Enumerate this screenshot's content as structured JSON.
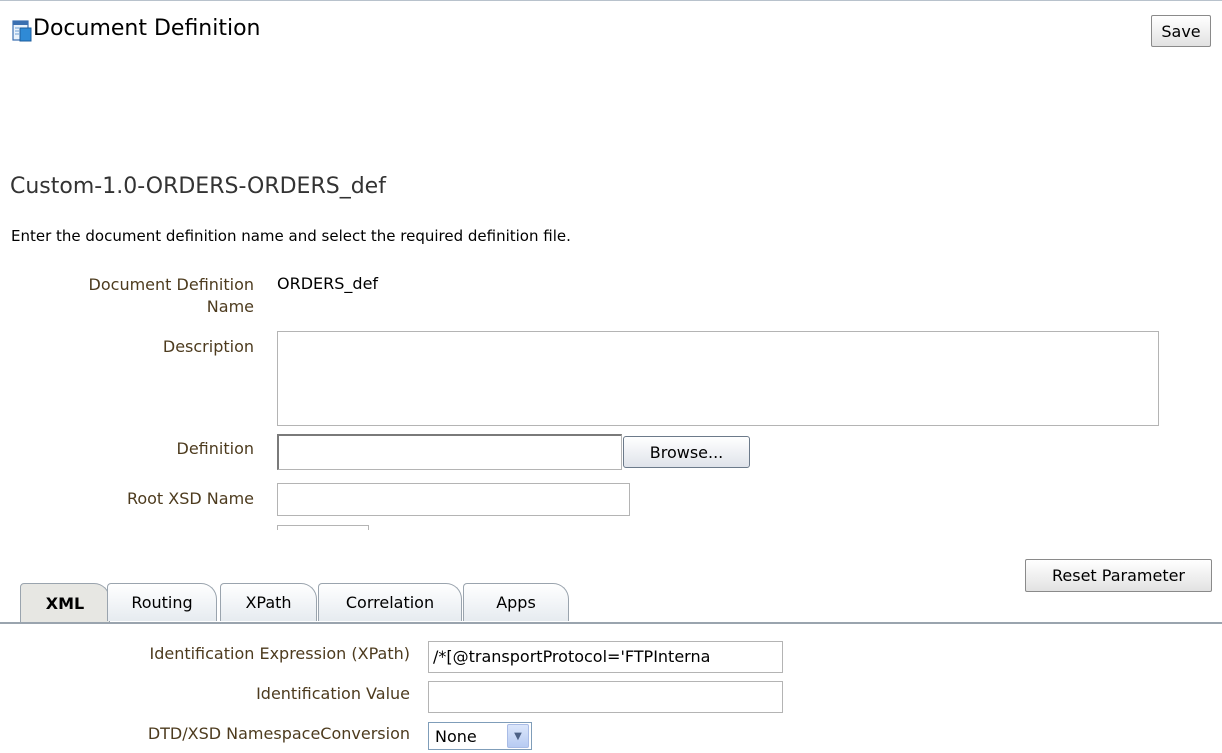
{
  "header": {
    "title": "Document Definition",
    "save_label": "Save"
  },
  "section": {
    "title": "Custom-1.0-ORDERS-ORDERS_def",
    "instructions": "Enter the document definition name and select the required definition file."
  },
  "form": {
    "name_label_line1": "Document Definition",
    "name_label_line2": "Name",
    "name_value": "ORDERS_def",
    "description_label": "Description",
    "description_value": "",
    "definition_label": "Definition",
    "definition_value": "",
    "browse_label": "Browse...",
    "root_xsd_label": "Root XSD Name",
    "root_xsd_value": ""
  },
  "reset_label": "Reset Parameter",
  "tabs": [
    {
      "label": "XML",
      "active": true
    },
    {
      "label": "Routing",
      "active": false
    },
    {
      "label": "XPath",
      "active": false
    },
    {
      "label": "Correlation",
      "active": false
    },
    {
      "label": "Apps",
      "active": false
    }
  ],
  "xml_tab": {
    "id_expr_label": "Identification Expression (XPath)",
    "id_expr_value": "/*[@transportProtocol='FTPInterna",
    "id_value_label": "Identification Value",
    "id_value_value": "",
    "ns_conv_label": "DTD/XSD NamespaceConversion",
    "ns_conv_value": "None"
  },
  "icons": {
    "title_icon": "document-definition-icon",
    "dropdown_icon": "chevron-down-icon"
  },
  "colors": {
    "label_text": "#4d3b1e",
    "tab_border": "#9aa4ae",
    "active_tab": "#e7e7e3"
  }
}
